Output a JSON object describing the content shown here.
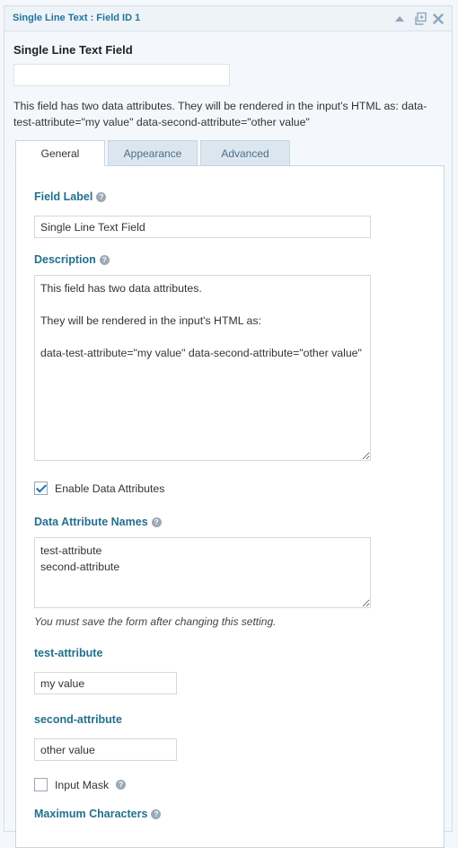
{
  "header": {
    "title": "Single Line Text : Field ID 1",
    "icons": [
      "collapse-icon",
      "duplicate-icon",
      "delete-icon"
    ]
  },
  "preview": {
    "label": "Single Line Text Field",
    "value": "",
    "description": "This field has two data attributes. They will be rendered in the input's HTML as: data-test-attribute=\"my value\" data-second-attribute=\"other value\""
  },
  "tabs": [
    {
      "label": "General",
      "active": true
    },
    {
      "label": "Appearance",
      "active": false
    },
    {
      "label": "Advanced",
      "active": false
    }
  ],
  "general": {
    "field_label": {
      "label": "Field Label",
      "value": "Single Line Text Field"
    },
    "description": {
      "label": "Description",
      "value": "This field has two data attributes.\n\nThey will be rendered in the input's HTML as:\n\ndata-test-attribute=\"my value\" data-second-attribute=\"other value\""
    },
    "enable_data_attributes": {
      "label": "Enable Data Attributes",
      "checked": true
    },
    "data_attribute_names": {
      "label": "Data Attribute Names",
      "value": "test-attribute\nsecond-attribute",
      "note": "You must save the form after changing this setting."
    },
    "test_attribute": {
      "label": "test-attribute",
      "value": "my value"
    },
    "second_attribute": {
      "label": "second-attribute",
      "value": "other value"
    },
    "input_mask": {
      "label": "Input Mask",
      "checked": false
    },
    "maximum_characters": {
      "label": "Maximum Characters"
    }
  },
  "colors": {
    "accent": "#21759b",
    "label": "#23708d",
    "tab_inactive": "#dce6ef",
    "background": "#f4f8fc"
  }
}
